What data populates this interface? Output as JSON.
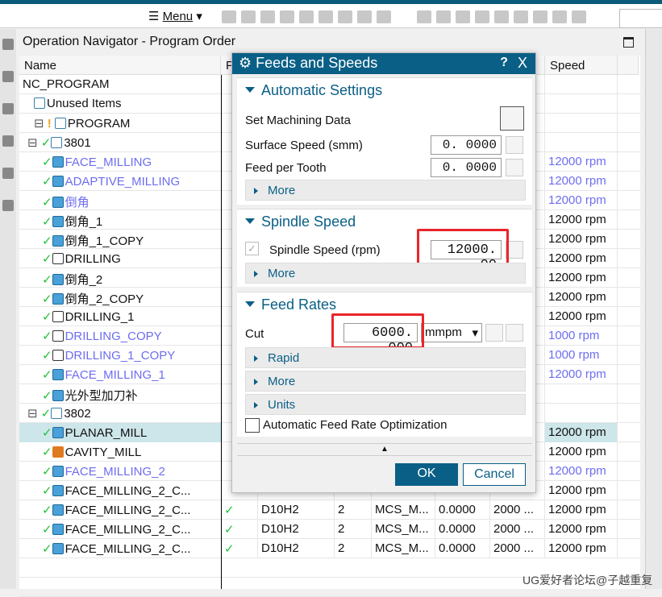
{
  "toolbar": {
    "menu_label": "Menu"
  },
  "navigator": {
    "title": "Operation Navigator - Program Order",
    "columns": [
      "Name",
      "P",
      "",
      "",
      "",
      "",
      "",
      "Speed",
      ""
    ],
    "rows": [
      {
        "name": "NC_PROGRAM",
        "level": 0,
        "icon": "none",
        "check": false,
        "color": "normal",
        "speed": ""
      },
      {
        "name": "Unused Items",
        "level": 1,
        "icon": "folder",
        "check": false,
        "color": "normal",
        "speed": ""
      },
      {
        "name": "PROGRAM",
        "level": 1,
        "icon": "program",
        "check": false,
        "warn": true,
        "color": "normal",
        "speed": ""
      },
      {
        "name": "3801",
        "level": 2,
        "icon": "program",
        "check": true,
        "color": "normal",
        "speed": ""
      },
      {
        "name": "FACE_MILLING",
        "level": 3,
        "icon": "face",
        "check": true,
        "color": "blue",
        "speed": "12000 rpm"
      },
      {
        "name": "ADAPTIVE_MILLING",
        "level": 3,
        "icon": "adaptive",
        "check": true,
        "color": "blue",
        "speed": "12000 rpm"
      },
      {
        "name": "倒角",
        "level": 3,
        "icon": "face",
        "check": true,
        "color": "blue",
        "speed": "12000 rpm"
      },
      {
        "name": "倒角_1",
        "level": 3,
        "icon": "face",
        "check": true,
        "color": "normal",
        "speed": "12000 rpm"
      },
      {
        "name": "倒角_1_COPY",
        "level": 3,
        "icon": "face",
        "check": true,
        "color": "normal",
        "speed": "12000 rpm"
      },
      {
        "name": "DRILLING",
        "level": 3,
        "icon": "drill",
        "check": true,
        "color": "normal",
        "speed": "12000 rpm"
      },
      {
        "name": "倒角_2",
        "level": 3,
        "icon": "face",
        "check": true,
        "color": "normal",
        "speed": "12000 rpm"
      },
      {
        "name": "倒角_2_COPY",
        "level": 3,
        "icon": "face",
        "check": true,
        "color": "normal",
        "speed": "12000 rpm"
      },
      {
        "name": "DRILLING_1",
        "level": 3,
        "icon": "drill",
        "check": true,
        "color": "normal",
        "speed": "12000 rpm"
      },
      {
        "name": "DRILLING_COPY",
        "level": 3,
        "icon": "drill",
        "check": true,
        "color": "blue",
        "speed": "1000 rpm"
      },
      {
        "name": "DRILLING_1_COPY",
        "level": 3,
        "icon": "drill",
        "check": true,
        "color": "blue",
        "speed": "1000 rpm"
      },
      {
        "name": "FACE_MILLING_1",
        "level": 3,
        "icon": "face",
        "check": true,
        "color": "blue",
        "speed": "12000 rpm"
      },
      {
        "name": "光外型加刀补",
        "level": 3,
        "icon": "face",
        "check": true,
        "color": "normal",
        "speed": ""
      },
      {
        "name": "3802",
        "level": 2,
        "icon": "program",
        "check": true,
        "color": "normal",
        "speed": ""
      },
      {
        "name": "PLANAR_MILL",
        "level": 3,
        "icon": "planar",
        "check": true,
        "color": "normal",
        "speed": "12000 rpm",
        "selected": true
      },
      {
        "name": "CAVITY_MILL",
        "level": 3,
        "icon": "cavity",
        "check": true,
        "color": "normal",
        "speed": "12000 rpm"
      },
      {
        "name": "FACE_MILLING_2",
        "level": 3,
        "icon": "face",
        "check": true,
        "color": "blue",
        "speed": "12000 rpm"
      },
      {
        "name": "FACE_MILLING_2_C...",
        "level": 3,
        "icon": "face",
        "check": true,
        "color": "normal",
        "speed": "12000 rpm"
      },
      {
        "name": "FACE_MILLING_2_C...",
        "level": 3,
        "icon": "face",
        "check": true,
        "color": "normal",
        "speed": "12000 rpm",
        "pcheck": "✓",
        "tool": "D10H2",
        "c3": "2",
        "c4": "MCS_M...",
        "c5": "0.0000",
        "c6": "2000 ..."
      },
      {
        "name": "FACE_MILLING_2_C...",
        "level": 3,
        "icon": "face",
        "check": true,
        "color": "normal",
        "speed": "12000 rpm",
        "pcheck": "✓",
        "tool": "D10H2",
        "c3": "2",
        "c4": "MCS_M...",
        "c5": "0.0000",
        "c6": "2000 ..."
      },
      {
        "name": "FACE_MILLING_2_C...",
        "level": 3,
        "icon": "face",
        "check": true,
        "color": "normal",
        "speed": "12000 rpm",
        "pcheck": "✓",
        "tool": "D10H2",
        "c3": "2",
        "c4": "MCS_M...",
        "c5": "0.0000",
        "c6": "2000 ..."
      }
    ]
  },
  "dialog": {
    "title": "Feeds and Speeds",
    "help": "?",
    "close": "X",
    "auto": {
      "header": "Automatic Settings",
      "set_data": "Set Machining Data",
      "surface_label": "Surface Speed (smm)",
      "surface_value": "0. 0000",
      "feed_label": "Feed per Tooth",
      "feed_value": "0. 0000",
      "more": "More"
    },
    "spindle": {
      "header": "Spindle Speed",
      "label": "Spindle Speed (rpm)",
      "value": "12000. 00",
      "checked": true,
      "more": "More"
    },
    "feed": {
      "header": "Feed Rates",
      "cut_label": "Cut",
      "cut_value": "6000. 000",
      "unit": "mmpm",
      "rapid": "Rapid",
      "more": "More",
      "units": "Units"
    },
    "optimization": {
      "label": "Automatic Feed Rate Optimization",
      "checked": false
    },
    "ok": "OK",
    "cancel": "Cancel"
  },
  "watermark": "UG爱好者论坛@子越重复",
  "colors": {
    "accent": "#0a5f86",
    "highlight": "#e8262a",
    "blue_text": "#6d6df0",
    "check": "#22c33a"
  }
}
